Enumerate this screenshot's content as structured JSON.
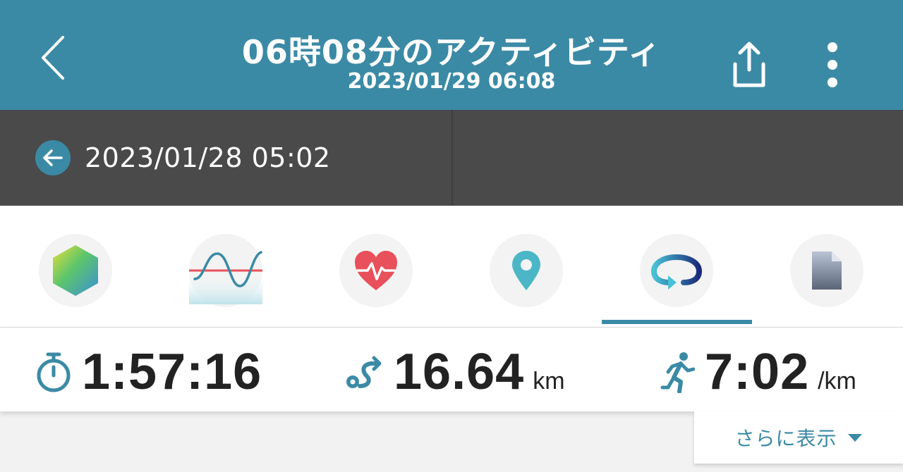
{
  "header": {
    "title": "06時08分のアクティビティ",
    "datetime": "2023/01/29 06:08",
    "back_icon": "chevron-left-icon",
    "share_icon": "share-icon",
    "more_icon": "more-vertical-icon"
  },
  "nav": {
    "previous_activity_datetime": "2023/01/28 05:02",
    "previous_icon": "arrow-left-circle-icon"
  },
  "tabs": [
    {
      "icon": "hexagon-gradient-icon"
    },
    {
      "icon": "wave-chart-icon"
    },
    {
      "icon": "heart-rate-icon"
    },
    {
      "icon": "location-pin-icon"
    },
    {
      "icon": "lap-loop-icon",
      "selected": true
    },
    {
      "icon": "document-icon"
    }
  ],
  "stats": {
    "duration": {
      "icon": "stopwatch-icon",
      "value": "1:57:16"
    },
    "distance": {
      "icon": "route-icon",
      "value": "16.64",
      "unit": "km"
    },
    "pace": {
      "icon": "runner-icon",
      "value": "7:02",
      "unit": "/km"
    }
  },
  "show_more": {
    "label": "さらに表示",
    "icon": "caret-down-icon"
  },
  "colors": {
    "accent": "#3b8aa5",
    "nav_bg": "#4a4a4a",
    "heart": "#e8505b"
  }
}
